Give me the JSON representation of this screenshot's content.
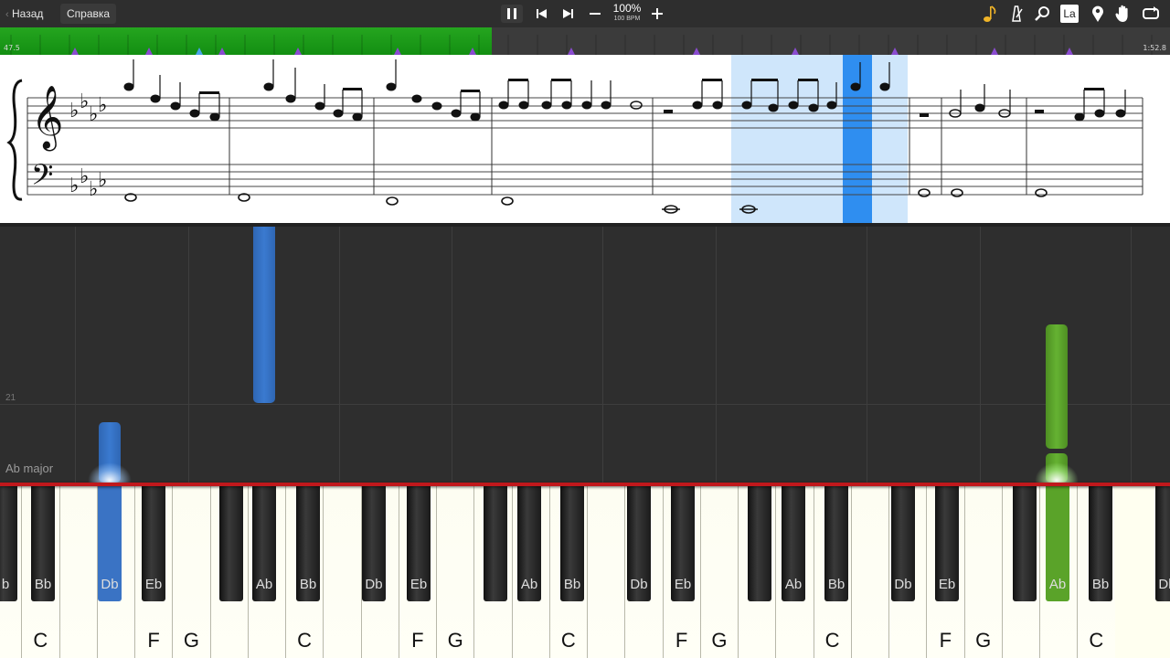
{
  "toolbar": {
    "back_label": "Назад",
    "help_label": "Справка",
    "zoom_label": "100%",
    "tempo_label": "100 BPM",
    "key_button_label": "La"
  },
  "progress": {
    "start_time": "47.5",
    "end_time": "1:52.8",
    "played_fraction": 0.42
  },
  "roll": {
    "measure_number": "21",
    "key_signature": "Ab major"
  },
  "keyboard": {
    "white_labels": [
      "",
      "C",
      "",
      "",
      "F",
      "G",
      "",
      "",
      "C",
      "",
      "",
      "F",
      "G",
      "",
      "",
      "C",
      "",
      "",
      "F",
      "G",
      "",
      "",
      "C",
      "",
      "",
      "F",
      "G",
      "",
      "",
      "C"
    ],
    "black_labels": [
      "b",
      "Bb",
      "Db",
      "Eb",
      "",
      "Ab",
      "Bb",
      "Db",
      "Eb",
      "",
      "Ab",
      "Bb",
      "Db",
      "Eb",
      "",
      "Ab",
      "Bb",
      "Db",
      "Eb",
      "",
      "Ab",
      "Bb",
      "Db"
    ]
  },
  "colors": {
    "left_hand": "#3a73c4",
    "right_hand": "#5aa329",
    "progress_green": "#1c9a19",
    "playhead": "#2f8ef0"
  }
}
